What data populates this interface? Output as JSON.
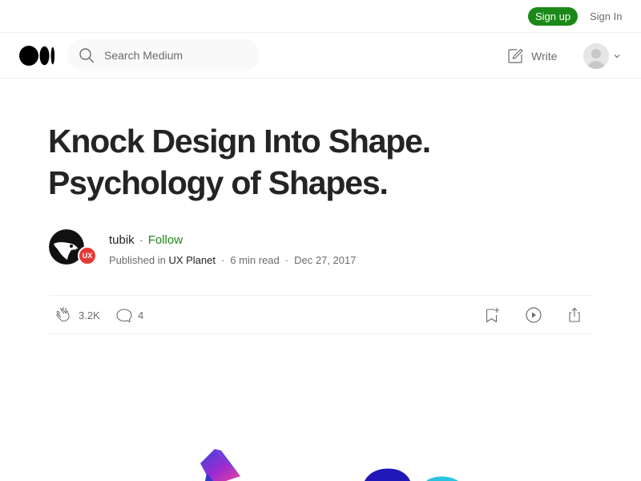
{
  "topbar": {
    "signup_label": "Sign up",
    "signin_label": "Sign In"
  },
  "header": {
    "logo": "medium-logo",
    "search": {
      "placeholder": "Search Medium",
      "icon": "search-icon"
    },
    "write_label": "Write",
    "write_icon": "write-icon"
  },
  "article": {
    "title_line1": "Knock Design Into Shape.",
    "title_line2": "Psychology of Shapes.",
    "author": {
      "name": "tubik",
      "separator": "·",
      "follow_label": "Follow"
    },
    "meta": {
      "published_in_label": "Published in",
      "publication": "UX Planet",
      "publication_badge": "UX",
      "read_time": "6 min read",
      "date": "Dec 27, 2017",
      "separator": "·"
    },
    "stats": {
      "claps": "3.2K",
      "responses": "4"
    }
  },
  "colors": {
    "accent_green": "#1a8917",
    "text_primary": "#242424",
    "text_secondary": "#6b6b6b",
    "badge_red": "#e53935"
  }
}
